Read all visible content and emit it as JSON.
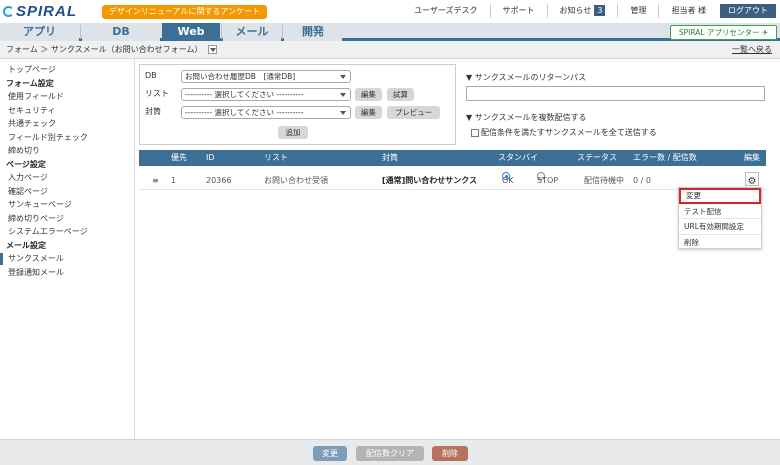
{
  "header": {
    "logo_text": "SPIRAL",
    "survey_label": "デザインリニューアルに関するアンケート",
    "links": [
      "ユーザーズデスク",
      "サポート",
      "お知らせ",
      "管理",
      "担当者 様"
    ],
    "notification_count": "3",
    "logout_label": "ログアウト",
    "survey_color": "#f39800",
    "brand_color": "#3c6f96"
  },
  "nav": {
    "tabs": [
      "アプリ",
      "DB",
      "Web",
      "メール",
      "開発"
    ],
    "active_tab": "Web",
    "app_center_label": "SPIRAL アプリセンター"
  },
  "breadcrumb": {
    "path": "フォーム ＞ サンクスメール（お問い合わせフォーム）",
    "back_label": "一覧へ戻る"
  },
  "sidebar": {
    "top": "トップページ",
    "form_section": "フォーム設定",
    "form_items": [
      "使用フィールド",
      "セキュリティ",
      "共通チェック",
      "フィールド別チェック",
      "締め切り"
    ],
    "page_section": "ページ設定",
    "page_items": [
      "入力ページ",
      "確認ページ",
      "サンキューページ",
      "締め切りページ",
      "システムエラーページ"
    ],
    "mail_section": "メール設定",
    "mail_items": [
      "サンクスメール",
      "登録通知メール"
    ],
    "active_item": "サンクスメール"
  },
  "form": {
    "db_label": "DB",
    "db_value": "お問い合わせ履歴DB　[通常DB]",
    "list_label": "リスト",
    "list_value": "---------- 選択してください ----------",
    "envelope_label": "封筒",
    "envelope_value": "---------- 選択してください ----------",
    "edit_label": "編集",
    "trial_label": "試算",
    "preview_label": "プレビュー",
    "add_label": "追加"
  },
  "return_path": {
    "title": "▼ サンクスメールのリターンパス",
    "value": "",
    "multi_title": "▼ サンクスメールを複数配信する",
    "multi_checkbox_label": "配信条件を満たすサンクスメールを全て送信する"
  },
  "table": {
    "headers": [
      "優先",
      "ID",
      "リスト",
      "封筒",
      "スタンバイ",
      "ステータス",
      "エラー数 / 配信数",
      "編集"
    ],
    "rows": [
      {
        "handle": "≡",
        "priority": "1",
        "id": "20366",
        "list": "お問い合わせ受領",
        "envelope": "[通常]問い合わせサンクス",
        "standby_ok": "OK",
        "standby_stop": "STOP",
        "standby_selected": "OK",
        "status": "配信待機中",
        "counts": "0 / 0"
      }
    ]
  },
  "context_menu": {
    "items": [
      "変更",
      "テスト配信",
      "URL有効期間設定",
      "削除"
    ],
    "highlighted": "変更"
  },
  "footer": {
    "change_label": "変更",
    "clear_label": "配信数クリア",
    "delete_label": "削除",
    "change_color": "#7f9db9",
    "clear_color": "#b4b4b4",
    "delete_color": "#b5735f"
  }
}
